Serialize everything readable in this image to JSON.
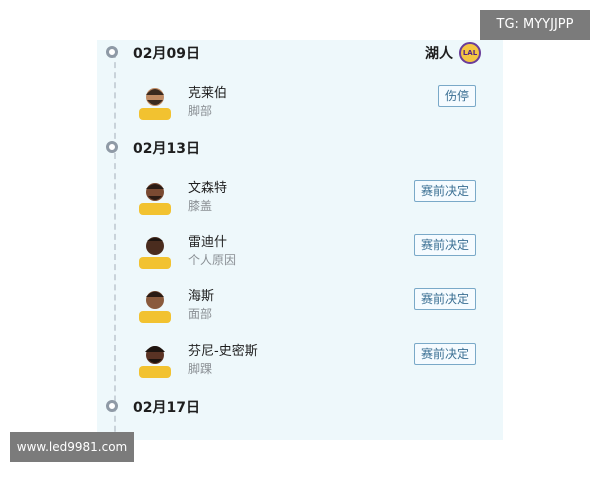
{
  "watermarks": {
    "tg": "TG: MYYJJPP",
    "site": "www.led9981.com"
  },
  "team": {
    "name": "湖人",
    "logo_text": "LAL",
    "logo_colors": {
      "gold": "#f4c542",
      "purple": "#552583"
    }
  },
  "timeline": [
    {
      "date": "02月09日",
      "players": [
        {
          "name": "克莱伯",
          "reason": "脚部",
          "status": "伤停"
        }
      ]
    },
    {
      "date": "02月13日",
      "players": [
        {
          "name": "文森特",
          "reason": "膝盖",
          "status": "赛前决定"
        },
        {
          "name": "雷迪什",
          "reason": "个人原因",
          "status": "赛前决定"
        },
        {
          "name": "海斯",
          "reason": "面部",
          "status": "赛前决定"
        },
        {
          "name": "芬尼-史密斯",
          "reason": "脚踝",
          "status": "赛前决定"
        }
      ]
    },
    {
      "date": "02月17日",
      "players": []
    }
  ],
  "colors": {
    "panel_bg": "#eef8fb",
    "status_border": "#7aa9c8",
    "status_text": "#3a6f93",
    "jersey": "#f2c230"
  }
}
